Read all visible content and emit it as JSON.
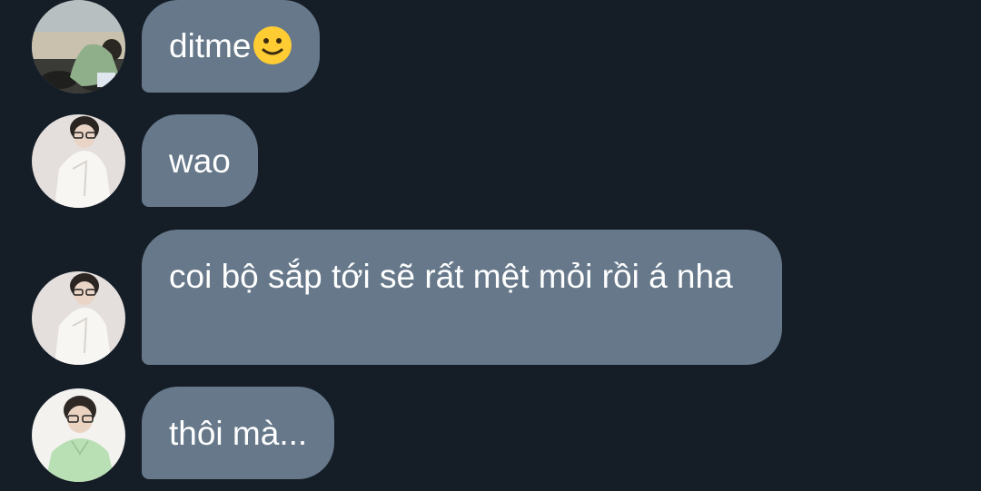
{
  "messages": [
    {
      "text": "ditme",
      "emoji": "slightly-smiling-face-emoji",
      "avatar": "user-avatar-beach"
    },
    {
      "text": "wao",
      "avatar": "user-avatar-white-shirt"
    },
    {
      "text": "coi bộ sắp tới sẽ rất mệt mỏi rồi á nha",
      "avatar": "user-avatar-white-shirt"
    },
    {
      "text": "thôi mà...",
      "avatar": "user-avatar-green-shirt"
    }
  ],
  "colors": {
    "background": "#151d27",
    "bubble": "#66788a",
    "text": "#ffffff"
  }
}
